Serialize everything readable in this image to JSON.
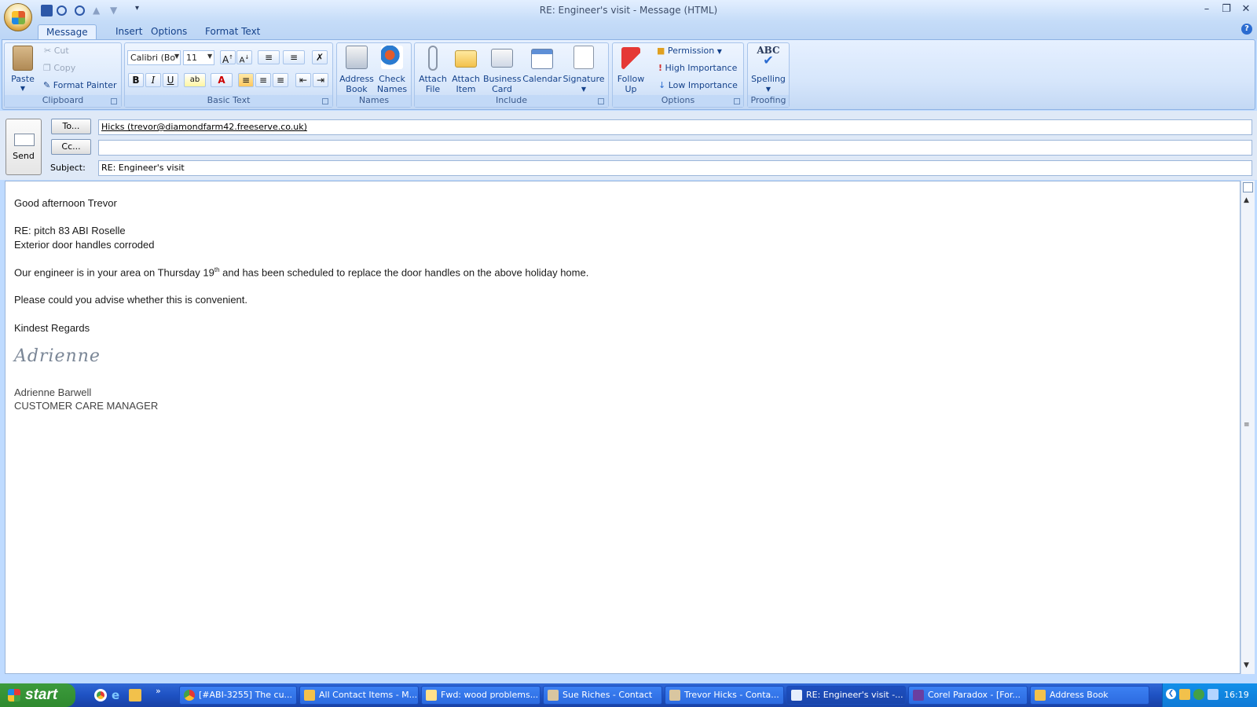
{
  "window": {
    "title": "RE: Engineer's visit - Message (HTML)",
    "controls": [
      "minimize-icon",
      "restore-icon",
      "close-icon"
    ]
  },
  "quick_access": [
    "save-icon",
    "undo-icon",
    "redo-icon",
    "previous-item-icon",
    "next-item-icon",
    "customize-qat-icon"
  ],
  "tabs": [
    {
      "label": "Message",
      "active": true
    },
    {
      "label": "Insert",
      "active": false
    },
    {
      "label": "Options",
      "active": false
    },
    {
      "label": "Format Text",
      "active": false
    }
  ],
  "ribbon": {
    "clipboard": {
      "label": "Clipboard",
      "paste": "Paste",
      "cut": "Cut",
      "copy": "Copy",
      "format_painter": "Format Painter"
    },
    "basic_text": {
      "label": "Basic Text",
      "font": "Calibri (Bo",
      "size": "11"
    },
    "names": {
      "label": "Names",
      "address_book_1": "Address",
      "address_book_2": "Book",
      "check_names_1": "Check",
      "check_names_2": "Names"
    },
    "include": {
      "label": "Include",
      "attach_file_1": "Attach",
      "attach_file_2": "File",
      "attach_item_1": "Attach",
      "attach_item_2": "Item",
      "business_card_1": "Business",
      "business_card_2": "Card",
      "calendar": "Calendar",
      "signature": "Signature"
    },
    "options": {
      "label": "Options",
      "follow_up_1": "Follow",
      "follow_up_2": "Up",
      "permission": "Permission",
      "high_importance": "High Importance",
      "low_importance": "Low Importance"
    },
    "proofing": {
      "label": "Proofing",
      "spelling": "Spelling",
      "spelling_icon_text": "ABC"
    }
  },
  "header": {
    "send": "Send",
    "to_button": "To...",
    "cc_button": "Cc...",
    "subject_label": "Subject:",
    "to_value": "Hicks (trevor@diamondfarm42.freeserve.co.uk)",
    "cc_value": "",
    "subject_value": "RE: Engineer's visit"
  },
  "message": {
    "greeting": "Good afternoon Trevor",
    "re_line": "RE: pitch 83 ABI Roselle",
    "issue_line": "Exterior door handles corroded",
    "body_part1": "Our engineer is in your area on Thursday 19",
    "body_sup": "th",
    "body_part2": " and has been scheduled to replace the door handles on the above holiday home.",
    "request": "Please could you advise whether this is convenient.",
    "closing": "Kindest Regards",
    "signature_script": "Adrienne",
    "signer_name": "Adrienne Barwell",
    "signer_title": "CUSTOMER CARE MANAGER"
  },
  "taskbar": {
    "start": "start",
    "items": [
      {
        "label": "[#ABI-3255] The cu...",
        "icon": "chrome-icon",
        "active": false
      },
      {
        "label": "All Contact Items - M...",
        "icon": "outlook-icon",
        "active": false
      },
      {
        "label": "Fwd: wood problems...",
        "icon": "mail-icon",
        "active": false
      },
      {
        "label": "Sue Riches - Contact",
        "icon": "contact-icon",
        "active": false
      },
      {
        "label": "Trevor Hicks - Conta...",
        "icon": "contact-icon",
        "active": false
      },
      {
        "label": "RE: Engineer's visit -...",
        "icon": "mail-icon",
        "active": true
      },
      {
        "label": "Corel Paradox - [For...",
        "icon": "paradox-icon",
        "active": false
      },
      {
        "label": "Address Book",
        "icon": "address-book-icon",
        "active": false
      }
    ],
    "clock": "16:19"
  }
}
